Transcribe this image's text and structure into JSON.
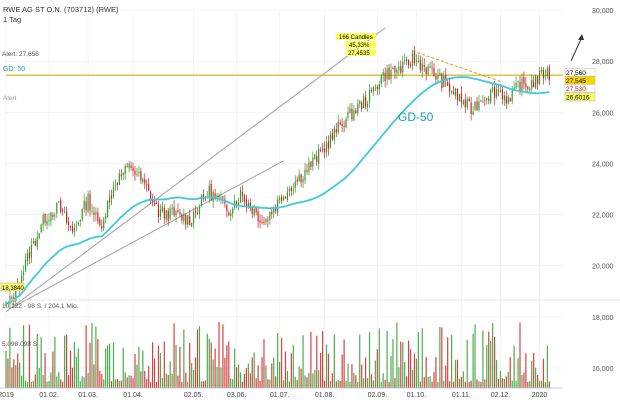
{
  "header": {
    "title": "RWE AG ST O.N. (703712) (RWE)",
    "interval": "1 Tag"
  },
  "left_labels": {
    "alert_line": "Alert: 27,656",
    "gd": "GD: 50",
    "alert_generic": "Alert"
  },
  "volume_labels": {
    "low_value": "10,122 · 98 S. / 204,1 Mio.",
    "volume_top": "5.098.098 S."
  },
  "annotations": {
    "candles_box": [
      "166 Candles",
      "45,33%",
      "27,4535"
    ],
    "gd50_label": "GD-50",
    "start_value": "18,3840"
  },
  "price_tags": [
    {
      "text": "27,560",
      "price": 27.56,
      "bg": "#ffffff",
      "fg": "#000000"
    },
    {
      "text": "27,545",
      "price": 27.4,
      "bg": "#ffd400",
      "fg": "#000000"
    },
    {
      "text": "27,530",
      "price": 26.95,
      "bg": "#ffffff",
      "fg": "#d01818"
    },
    {
      "text": "26,6016",
      "price": 26.6,
      "bg": "#ffff66",
      "fg": "#000000"
    }
  ],
  "colors": {
    "up": "#2e9d2e",
    "down": "#cc2222",
    "ma": "#3fc9dc",
    "trend": "#a0a0a0",
    "resistance": "#e8a020",
    "alert": "#d4b000",
    "grid": "#eeeeee"
  },
  "chart_data": {
    "type": "candlestick",
    "title": "RWE AG ST O.N. (703712) (RWE)",
    "interval": "1 Tag",
    "ylim": [
      16,
      30
    ],
    "yticks": [
      "16,000",
      "18,000",
      "20,000",
      "22,000",
      "24,000",
      "26,000",
      "28,000",
      "30,000"
    ],
    "y_values": [
      16,
      18,
      20,
      22,
      24,
      26,
      28,
      30
    ],
    "xticks": [
      "2019",
      "01.02.",
      "01.03.",
      "01.04.",
      "02.05.",
      "03.06.",
      "01.07.",
      "01.08.",
      "02.09.",
      "01.10.",
      "01.11.",
      "02.12.",
      "2020"
    ],
    "xtick_pos": [
      0,
      22,
      42,
      65,
      96,
      118,
      140,
      163,
      190,
      210,
      233,
      253,
      273
    ],
    "total_days": 285,
    "price_path": [
      [
        0,
        18.4
      ],
      [
        4,
        18.8
      ],
      [
        12,
        20.5
      ],
      [
        20,
        21.9
      ],
      [
        27,
        22.3
      ],
      [
        34,
        21.3
      ],
      [
        42,
        22.6
      ],
      [
        48,
        21.5
      ],
      [
        56,
        23.3
      ],
      [
        64,
        23.9
      ],
      [
        72,
        23.0
      ],
      [
        78,
        22.1
      ],
      [
        86,
        22.0
      ],
      [
        94,
        21.8
      ],
      [
        104,
        22.9
      ],
      [
        114,
        22.2
      ],
      [
        120,
        22.8
      ],
      [
        132,
        21.7
      ],
      [
        142,
        22.8
      ],
      [
        152,
        23.6
      ],
      [
        162,
        24.5
      ],
      [
        172,
        25.6
      ],
      [
        180,
        26.2
      ],
      [
        186,
        26.6
      ],
      [
        192,
        27.4
      ],
      [
        198,
        27.6
      ],
      [
        205,
        27.8
      ],
      [
        208,
        28.1
      ],
      [
        214,
        27.8
      ],
      [
        222,
        27.3
      ],
      [
        230,
        26.7
      ],
      [
        238,
        26.1
      ],
      [
        244,
        26.6
      ],
      [
        252,
        26.9
      ],
      [
        258,
        26.4
      ],
      [
        262,
        27.1
      ],
      [
        266,
        27.0
      ],
      [
        272,
        27.3
      ],
      [
        276,
        27.6
      ],
      [
        278,
        27.4
      ]
    ],
    "moving_average": {
      "name": "GD-50",
      "period": 50
    },
    "last_price": 27.56
  }
}
